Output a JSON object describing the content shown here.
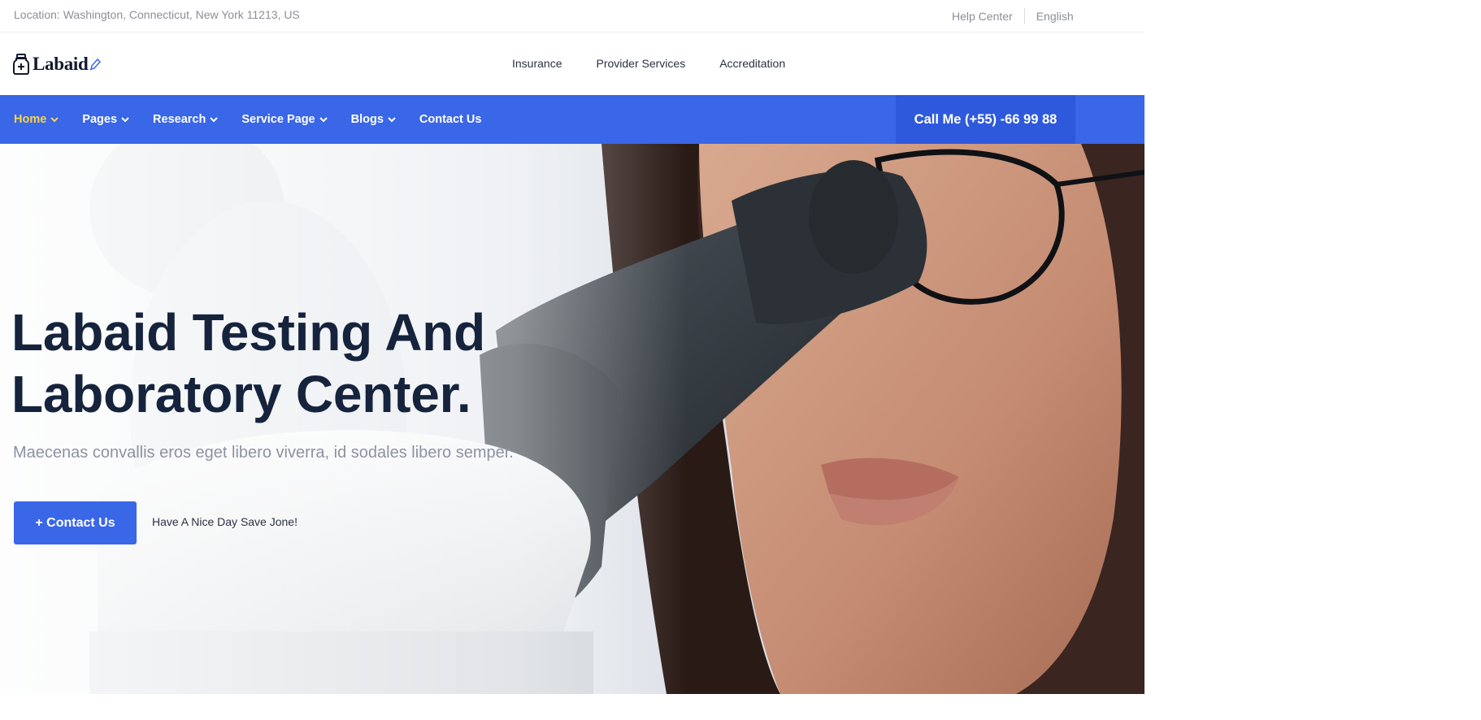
{
  "topbar": {
    "location": "Location: Washington, Connecticut, New York 11213, US",
    "help_center": "Help Center",
    "language": "English"
  },
  "header": {
    "logo_text": "Labaid",
    "links": [
      "Insurance",
      "Provider Services",
      "Accreditation"
    ]
  },
  "nav": {
    "items": [
      {
        "label": "Home",
        "dropdown": true,
        "active": true
      },
      {
        "label": "Pages",
        "dropdown": true
      },
      {
        "label": "Research",
        "dropdown": true
      },
      {
        "label": "Service Page",
        "dropdown": true
      },
      {
        "label": "Blogs",
        "dropdown": true
      },
      {
        "label": "Contact Us",
        "dropdown": false
      }
    ],
    "call_label": "Call Me (+55) -66 99 88"
  },
  "hero": {
    "title_line1": "Labaid Testing And",
    "title_line2": "Laboratory Center.",
    "subtitle": "Maecenas convallis eros eget libero viverra, id sodales libero semper.",
    "button_label": "+ Contact Us",
    "note": "Have A Nice Day Save Jone!"
  },
  "colors": {
    "primary": "#3a66e8",
    "call_box": "#2e59dc",
    "active_nav": "#ffd43c",
    "heading": "#16233d"
  },
  "icons": {
    "logo": "medicine-bottle-icon",
    "logo_mark": "pen-icon",
    "nav_dropdown": "chevron-down-icon"
  }
}
